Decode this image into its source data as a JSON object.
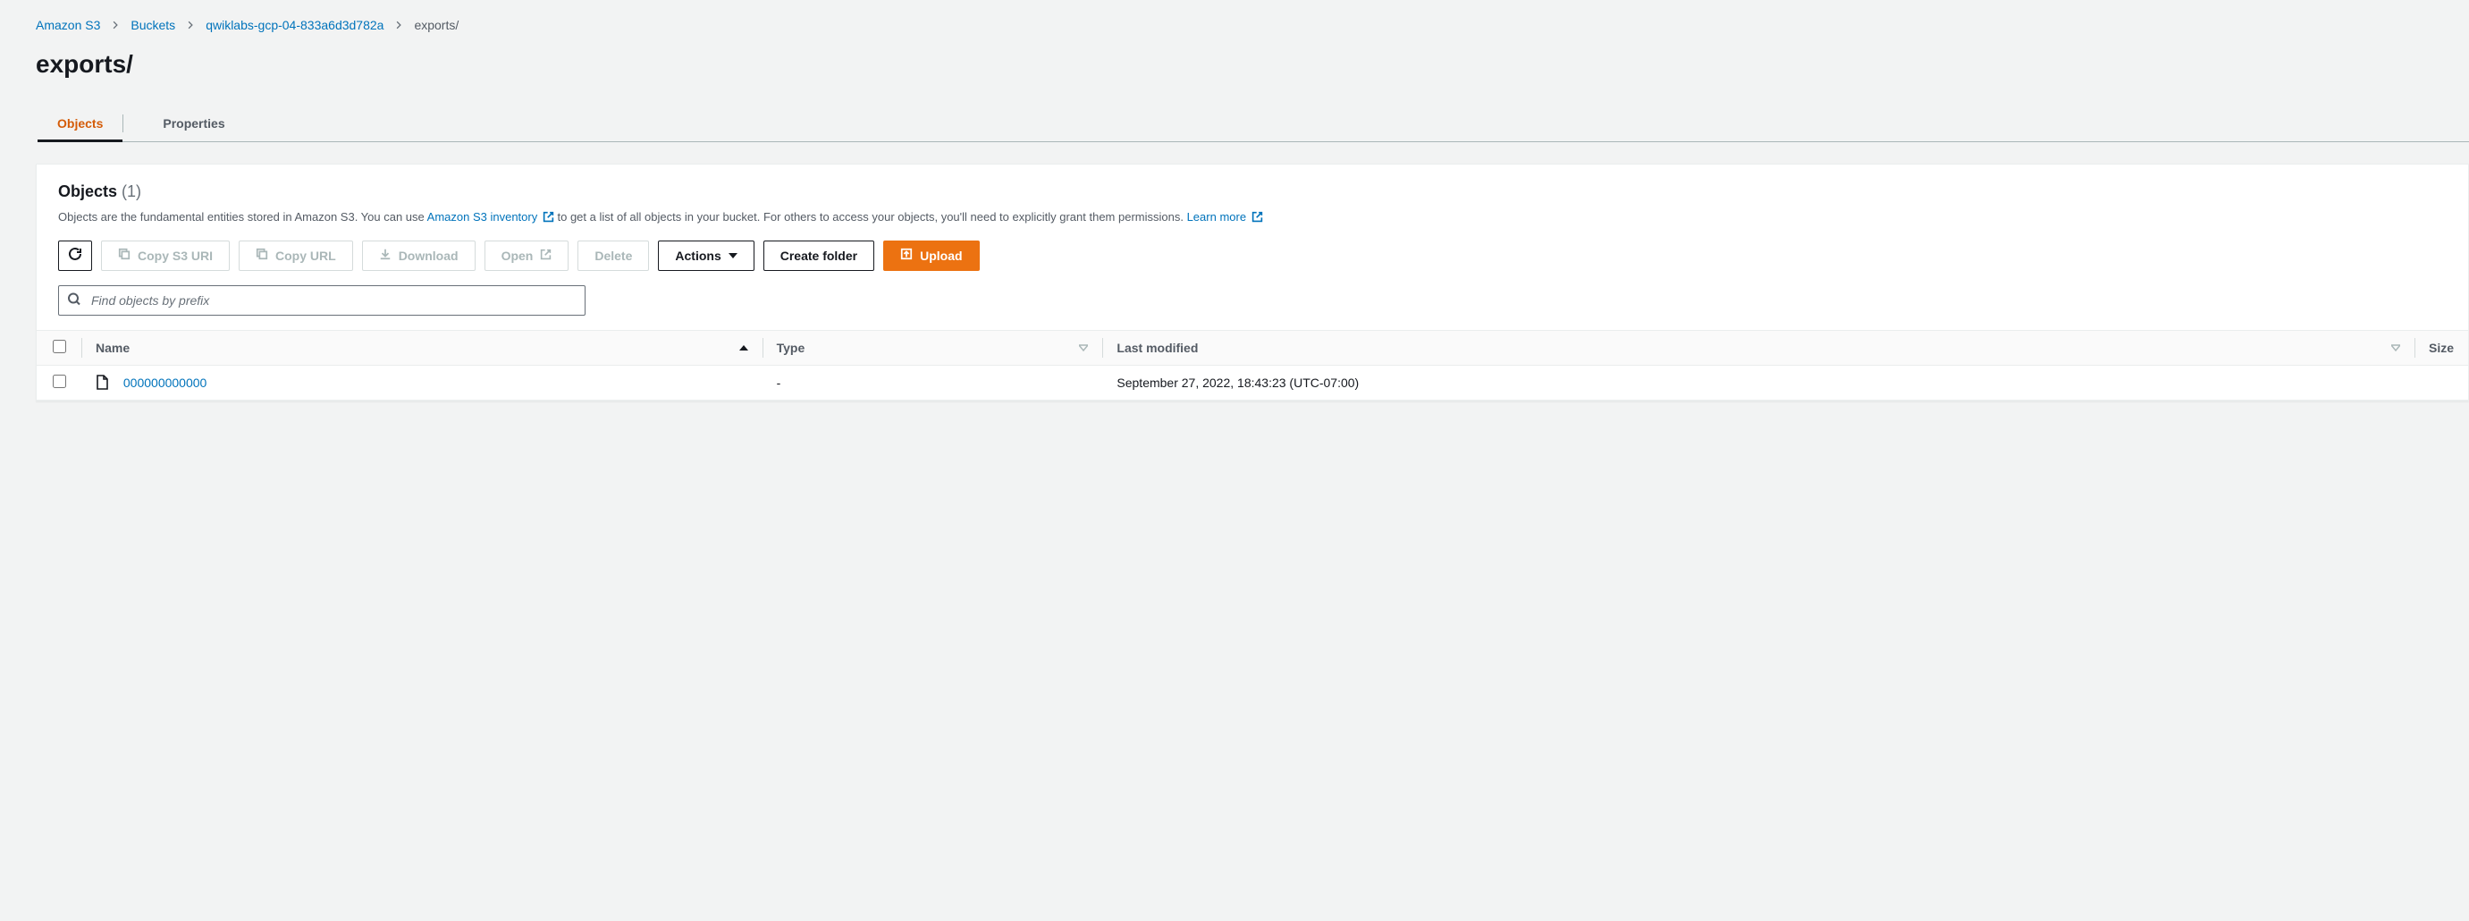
{
  "breadcrumb": {
    "root": "Amazon S3",
    "buckets": "Buckets",
    "bucket_name": "qwiklabs-gcp-04-833a6d3d782a",
    "current": "exports/"
  },
  "page_title": "exports/",
  "tabs": {
    "objects": "Objects",
    "properties": "Properties"
  },
  "panel": {
    "title": "Objects",
    "count": "(1)",
    "desc_pre": "Objects are the fundamental entities stored in Amazon S3. You can use ",
    "desc_link1": "Amazon S3 inventory",
    "desc_mid": " to get a list of all objects in your bucket. For others to access your objects, you'll need to explicitly grant them permissions. ",
    "desc_link2": "Learn more"
  },
  "toolbar": {
    "copy_s3_uri": "Copy S3 URI",
    "copy_url": "Copy URL",
    "download": "Download",
    "open": "Open",
    "delete": "Delete",
    "actions": "Actions",
    "create_folder": "Create folder",
    "upload": "Upload"
  },
  "search": {
    "placeholder": "Find objects by prefix"
  },
  "table": {
    "headers": {
      "name": "Name",
      "type": "Type",
      "last_modified": "Last modified",
      "size": "Size"
    },
    "rows": [
      {
        "name": "000000000000",
        "type": "-",
        "last_modified": "September 27, 2022, 18:43:23 (UTC-07:00)",
        "size": ""
      }
    ]
  }
}
